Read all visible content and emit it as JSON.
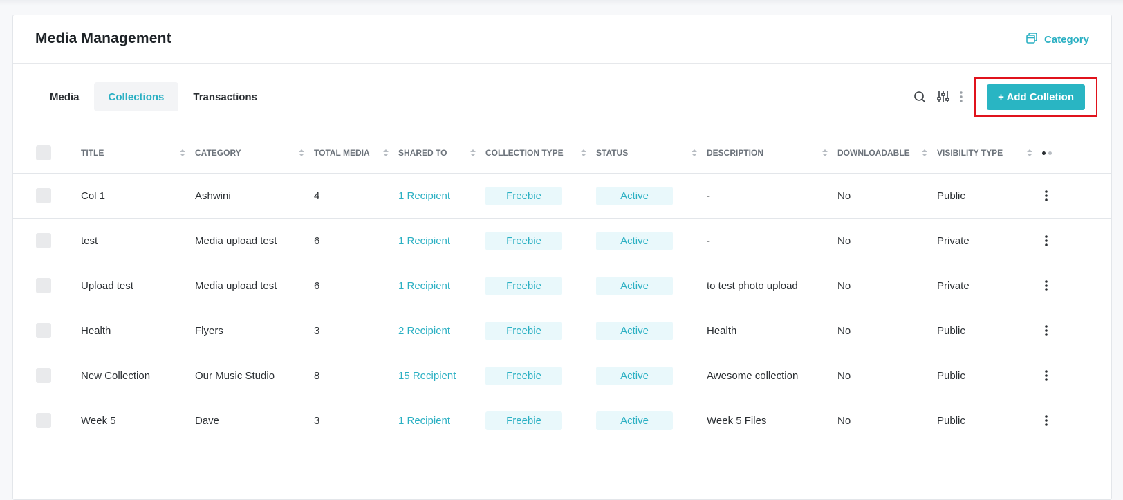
{
  "header": {
    "title": "Media Management",
    "category_label": "Category"
  },
  "tabs": [
    {
      "label": "Media",
      "active": false
    },
    {
      "label": "Collections",
      "active": true
    },
    {
      "label": "Transactions",
      "active": false
    }
  ],
  "toolbar": {
    "add_label": "+ Add Colletion"
  },
  "columns": [
    "TITLE",
    "CATEGORY",
    "TOTAL MEDIA",
    "SHARED TO",
    "COLLECTION TYPE",
    "STATUS",
    "DESCRIPTION",
    "DOWNLOADABLE",
    "VISIBILITY TYPE"
  ],
  "rows": [
    {
      "title": "Col 1",
      "category": "Ashwini",
      "total_media": "4",
      "shared_to": "1 Recipient",
      "collection_type": "Freebie",
      "status": "Active",
      "description": "-",
      "downloadable": "No",
      "visibility": "Public"
    },
    {
      "title": "test",
      "category": "Media upload test",
      "total_media": "6",
      "shared_to": "1 Recipient",
      "collection_type": "Freebie",
      "status": "Active",
      "description": "-",
      "downloadable": "No",
      "visibility": "Private"
    },
    {
      "title": "Upload test",
      "category": "Media upload test",
      "total_media": "6",
      "shared_to": "1 Recipient",
      "collection_type": "Freebie",
      "status": "Active",
      "description": "to test photo upload",
      "downloadable": "No",
      "visibility": "Private"
    },
    {
      "title": "Health",
      "category": "Flyers",
      "total_media": "3",
      "shared_to": "2 Recipient",
      "collection_type": "Freebie",
      "status": "Active",
      "description": "Health",
      "downloadable": "No",
      "visibility": "Public"
    },
    {
      "title": "New Collection",
      "category": "Our Music Studio",
      "total_media": "8",
      "shared_to": "15 Recipient",
      "collection_type": "Freebie",
      "status": "Active",
      "description": "Awesome collection",
      "downloadable": "No",
      "visibility": "Public"
    },
    {
      "title": "Week 5",
      "category": "Dave",
      "total_media": "3",
      "shared_to": "1 Recipient",
      "collection_type": "Freebie",
      "status": "Active",
      "description": "Week 5 Files",
      "downloadable": "No",
      "visibility": "Public"
    }
  ],
  "colors": {
    "accent": "#2bb0c3",
    "button": "#29b5c3",
    "highlight_border": "#e0131c"
  },
  "icons": {
    "category": "layers-icon",
    "search": "search-icon",
    "filter": "sliders-icon",
    "more": "kebab-icon"
  }
}
